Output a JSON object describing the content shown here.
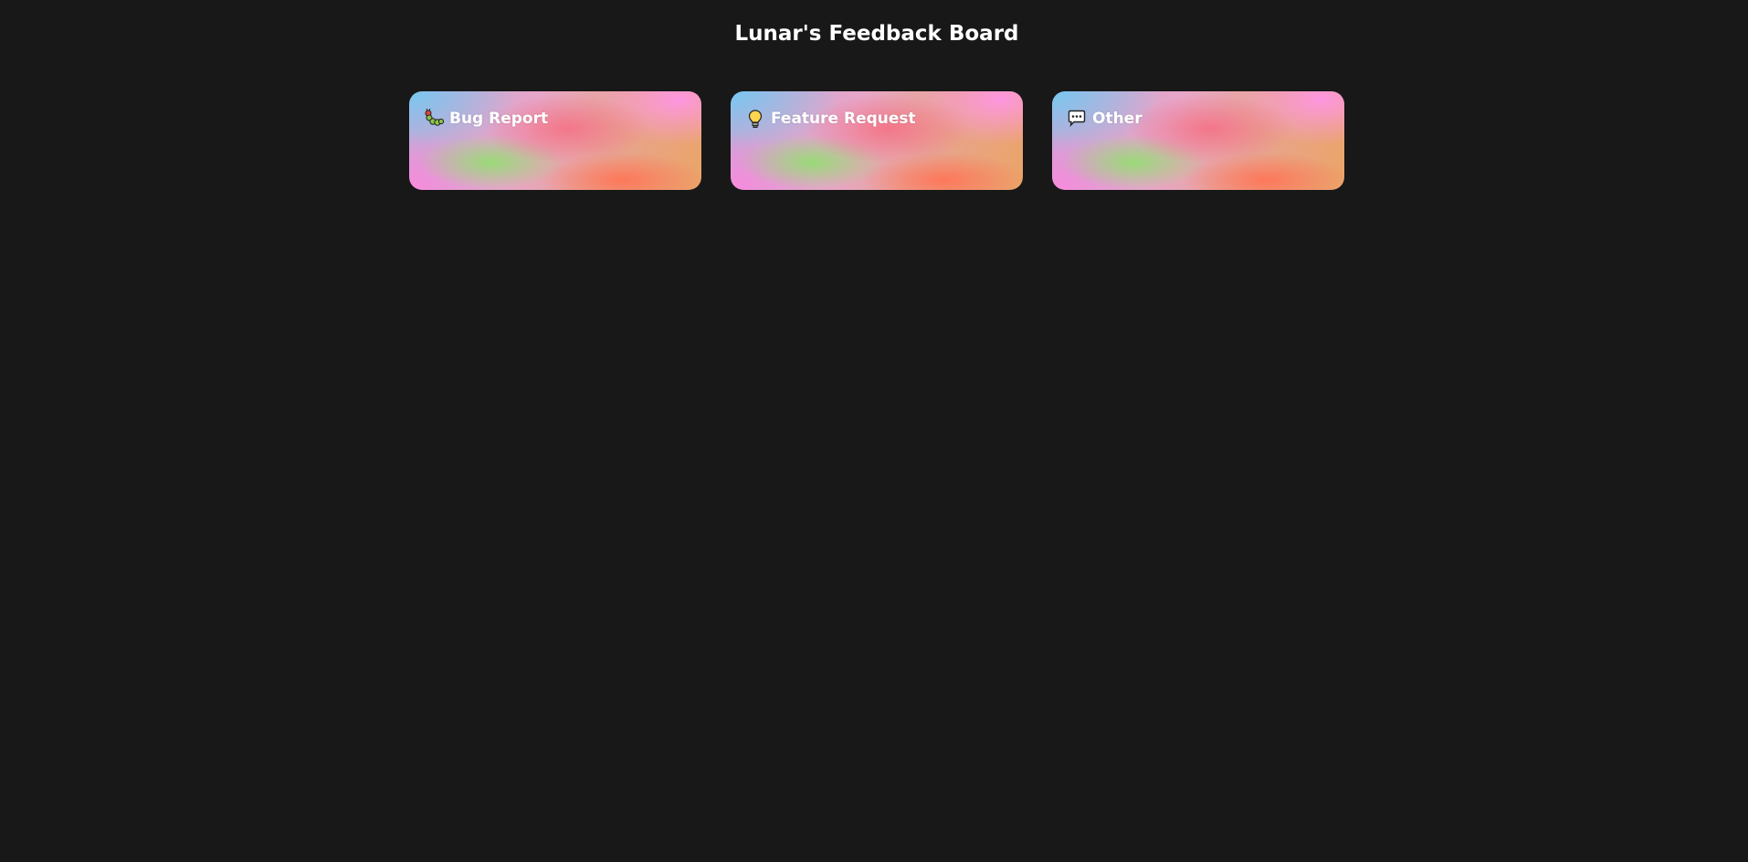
{
  "header": {
    "title": "Lunar's Feedback Board"
  },
  "categories": [
    {
      "label": "Bug Report",
      "icon": "bug-icon"
    },
    {
      "label": "Feature Request",
      "icon": "lightbulb-icon"
    },
    {
      "label": "Other",
      "icon": "speech-bubble-icon"
    }
  ],
  "colors": {
    "background": "#181818",
    "title_text": "#ffffff",
    "card_text": "#ffffff"
  }
}
